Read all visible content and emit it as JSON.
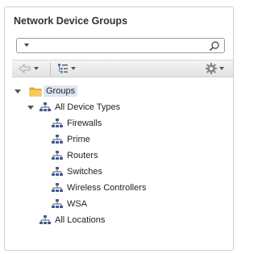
{
  "panel": {
    "title": "Network Device Groups"
  },
  "search": {
    "value": "",
    "placeholder": ""
  },
  "tree": {
    "root": {
      "label": "Groups"
    },
    "all_device_types": {
      "label": "All Device Types"
    },
    "device_types": [
      {
        "label": "Firewalls"
      },
      {
        "label": "Prime"
      },
      {
        "label": "Routers"
      },
      {
        "label": "Switches"
      },
      {
        "label": "Wireless Controllers"
      },
      {
        "label": "WSA"
      }
    ],
    "all_locations": {
      "label": "All Locations"
    }
  },
  "colors": {
    "folder": "#f2b53a",
    "selected_bg": "#dfe6f3",
    "network_icon": "#3a5f9a"
  }
}
